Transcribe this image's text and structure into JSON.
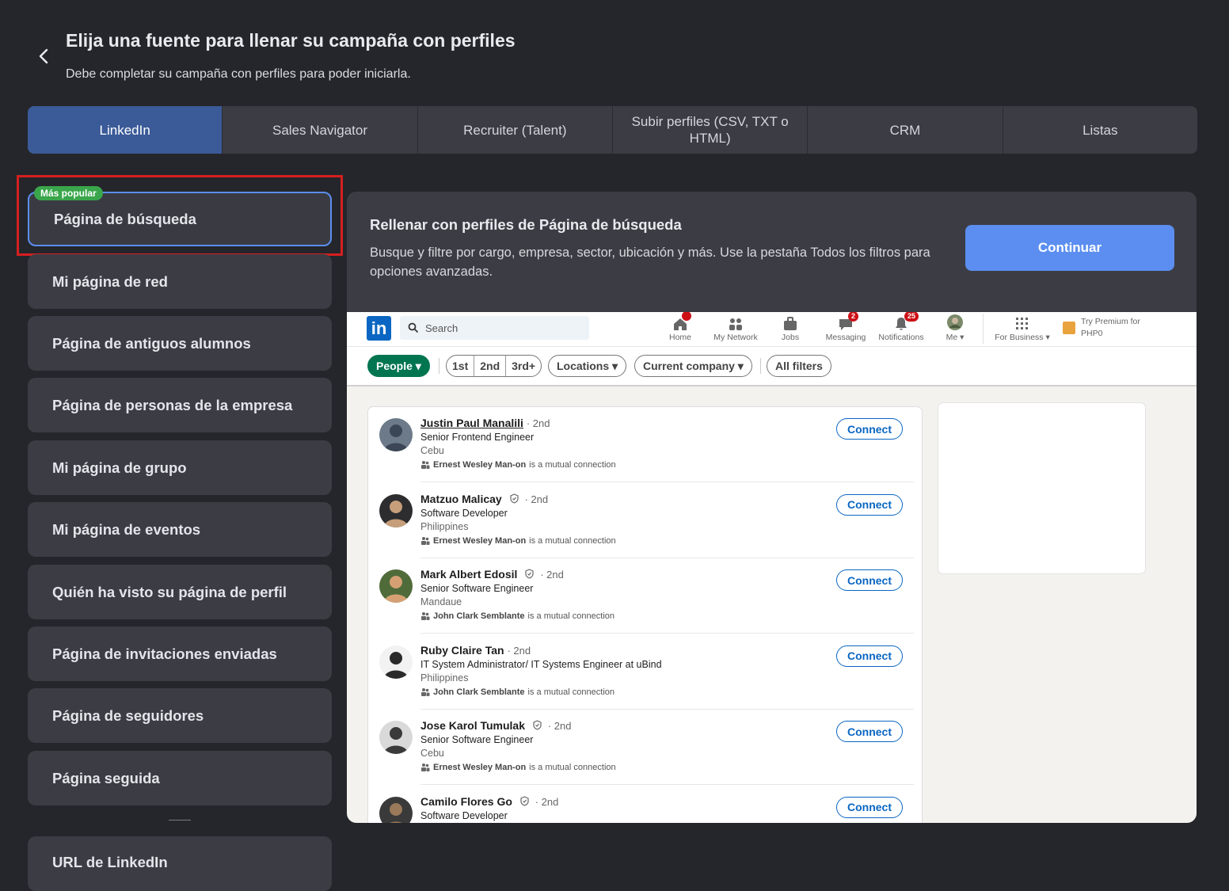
{
  "header": {
    "back_icon": "chevron-left-icon",
    "title": "Elija una fuente para llenar su campaña con perfiles",
    "subtitle": "Debe completar su campaña con perfiles para poder iniciarla."
  },
  "tabs": [
    {
      "label": "LinkedIn",
      "active": true
    },
    {
      "label": "Sales Navigator",
      "active": false
    },
    {
      "label": "Recruiter (Talent)",
      "active": false
    },
    {
      "label": "Subir perfiles (CSV, TXT o HTML)",
      "active": false
    },
    {
      "label": "CRM",
      "active": false
    },
    {
      "label": "Listas",
      "active": false
    }
  ],
  "sidebar": {
    "badge": "Más popular",
    "items": [
      {
        "label": "Página de búsqueda",
        "selected": true
      },
      {
        "label": "Mi página de red"
      },
      {
        "label": "Página de antiguos alumnos"
      },
      {
        "label": "Página de personas de la empresa"
      },
      {
        "label": "Mi página de grupo"
      },
      {
        "label": "Mi página de eventos"
      },
      {
        "label": "Quién ha visto su página de perfil"
      },
      {
        "label": "Página de invitaciones enviadas"
      },
      {
        "label": "Página de seguidores"
      },
      {
        "label": "Página seguida"
      }
    ],
    "last_item": "URL de LinkedIn"
  },
  "panel": {
    "title": "Rellenar con perfiles de Página de búsqueda",
    "description": "Busque y filtre por cargo, empresa, sector, ubicación y más. Use la pestaña Todos los filtros para opciones avanzadas.",
    "continue_label": "Continuar"
  },
  "linkedin": {
    "logo": "in",
    "search_placeholder": "Search",
    "nav": [
      {
        "label": "Home",
        "icon": "home-icon",
        "badge": "•"
      },
      {
        "label": "My Network",
        "icon": "network-icon",
        "badge": ""
      },
      {
        "label": "Jobs",
        "icon": "briefcase-icon",
        "badge": ""
      },
      {
        "label": "Messaging",
        "icon": "message-icon",
        "badge": "2"
      },
      {
        "label": "Notifications",
        "icon": "bell-icon",
        "badge": "25"
      },
      {
        "label": "Me ▾",
        "icon": "avatar-icon",
        "badge": ""
      },
      {
        "label": "For Business ▾",
        "icon": "grid-icon",
        "badge": ""
      }
    ],
    "premium": "Try Premium for PHP0",
    "filters": {
      "people": "People ▾",
      "first": "1st",
      "second": "2nd",
      "third": "3rd+",
      "locations": "Locations ▾",
      "company": "Current company ▾",
      "all": "All filters"
    },
    "connect_label": "Connect",
    "mutual_suffix": "is a mutual connection",
    "results": [
      {
        "name": "Justin Paul Manalili",
        "degree": "· 2nd",
        "verified": false,
        "title": "Senior Frontend Engineer",
        "location": "Cebu",
        "mutual": "Ernest Wesley Man-on"
      },
      {
        "name": "Matzuo Malicay",
        "degree": "· 2nd",
        "verified": true,
        "title": "Software Developer",
        "location": "Philippines",
        "mutual": "Ernest Wesley Man-on"
      },
      {
        "name": "Mark Albert Edosil",
        "degree": "· 2nd",
        "verified": true,
        "title": "Senior Software Engineer",
        "location": "Mandaue",
        "mutual": "John Clark Semblante"
      },
      {
        "name": "Ruby Claire Tan",
        "degree": "· 2nd",
        "verified": false,
        "title": "IT System Administrator/ IT Systems Engineer at uBind",
        "location": "Philippines",
        "mutual": "John Clark Semblante"
      },
      {
        "name": "Jose Karol Tumulak",
        "degree": "· 2nd",
        "verified": true,
        "title": "Senior Software Engineer",
        "location": "Cebu",
        "mutual": "Ernest Wesley Man-on"
      },
      {
        "name": "Camilo Flores Go",
        "degree": "· 2nd",
        "verified": true,
        "title": "Software Developer",
        "location": "",
        "mutual": ""
      }
    ]
  }
}
